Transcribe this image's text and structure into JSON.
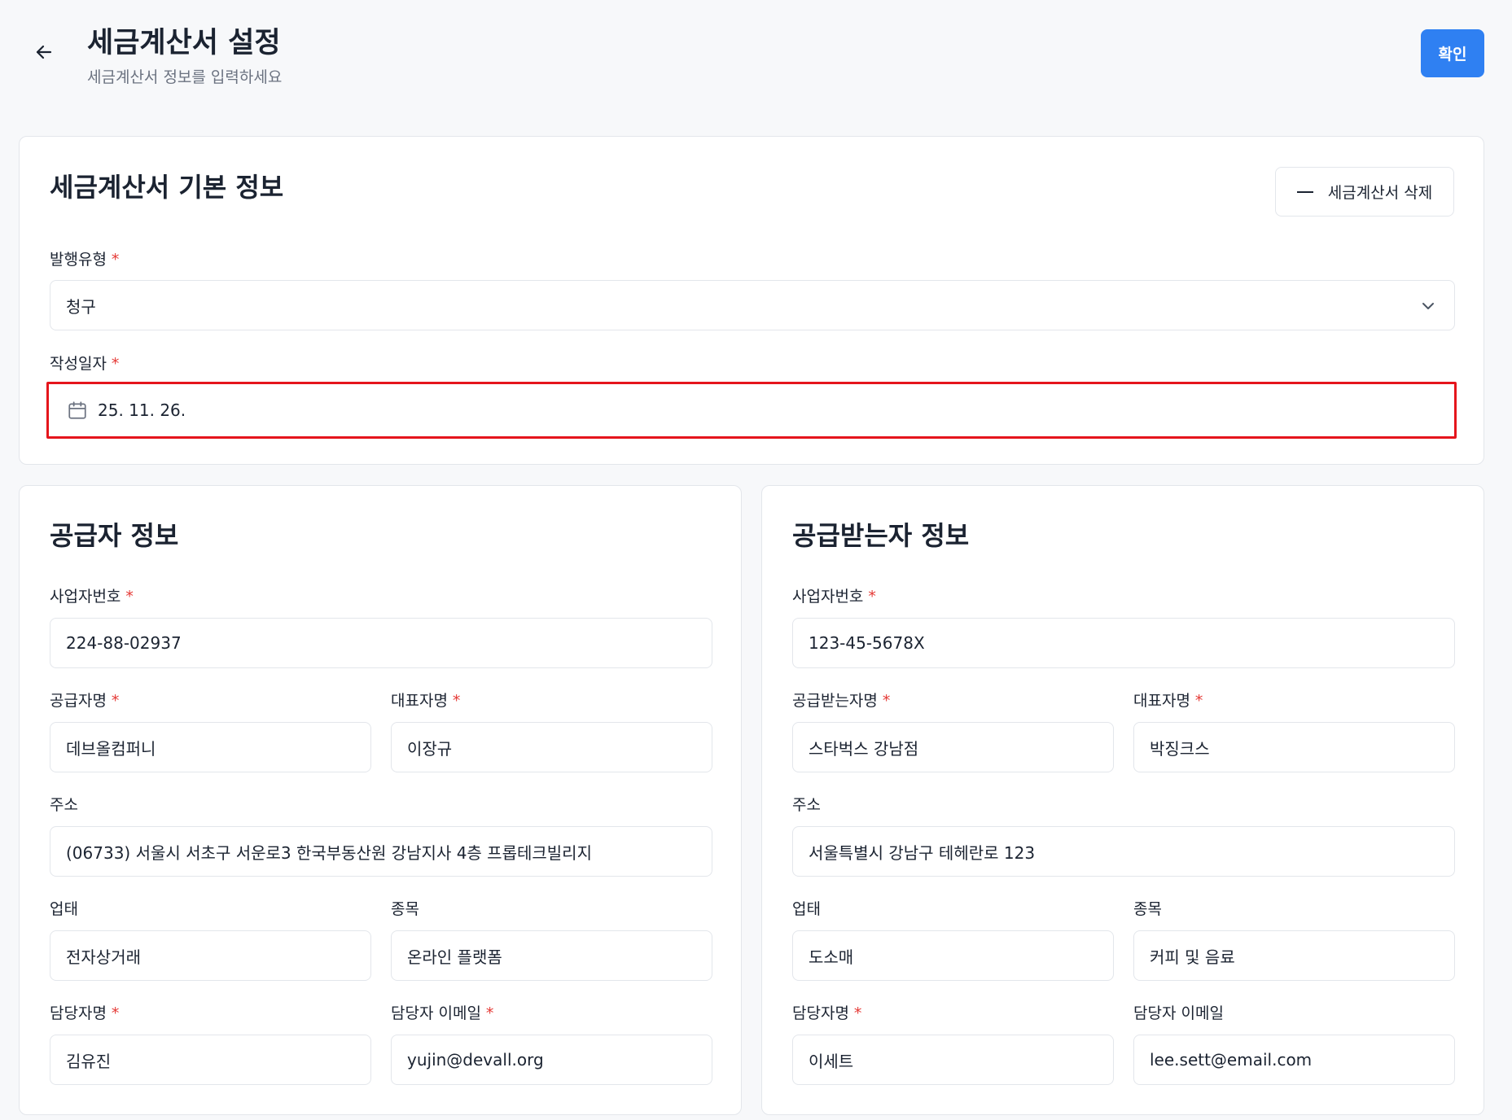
{
  "header": {
    "title": "세금계산서 설정",
    "subtitle": "세금계산서 정보를 입력하세요",
    "confirm_label": "확인"
  },
  "basic": {
    "title": "세금계산서 기본 정보",
    "delete_label": "세금계산서 삭제",
    "issue_type": {
      "label": "발행유형",
      "value": "청구"
    },
    "written_date": {
      "label": "작성일자",
      "value": "25. 11. 26."
    }
  },
  "supplier": {
    "title": "공급자 정보",
    "biz_no": {
      "label": "사업자번호",
      "value": "224-88-02937"
    },
    "name": {
      "label": "공급자명",
      "value": "데브올컴퍼니"
    },
    "ceo": {
      "label": "대표자명",
      "value": "이장규"
    },
    "address": {
      "label": "주소",
      "value": "(06733) 서울시 서초구 서운로3 한국부동산원 강남지사 4층 프롭테크빌리지"
    },
    "biz_type": {
      "label": "업태",
      "value": "전자상거래"
    },
    "biz_item": {
      "label": "종목",
      "value": "온라인 플랫폼"
    },
    "manager": {
      "label": "담당자명",
      "value": "김유진"
    },
    "email": {
      "label": "담당자 이메일",
      "value": "yujin@devall.org"
    }
  },
  "buyer": {
    "title": "공급받는자 정보",
    "biz_no": {
      "label": "사업자번호",
      "value": "123-45-5678X"
    },
    "name": {
      "label": "공급받는자명",
      "value": "스타벅스 강남점"
    },
    "ceo": {
      "label": "대표자명",
      "value": "박징크스"
    },
    "address": {
      "label": "주소",
      "value": "서울특별시 강남구 테헤란로 123"
    },
    "biz_type": {
      "label": "업태",
      "value": "도소매"
    },
    "biz_item": {
      "label": "종목",
      "value": "커피 및 음료"
    },
    "manager": {
      "label": "담당자명",
      "value": "이세트"
    },
    "email": {
      "label": "담당자 이메일",
      "value": "lee.sett@email.com"
    }
  },
  "required_mark": "*",
  "colors": {
    "accent": "#2f80f2",
    "required": "#e53935",
    "highlight": "#e5151c"
  }
}
